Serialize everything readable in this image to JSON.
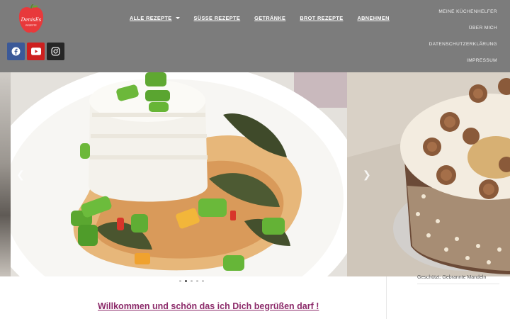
{
  "header": {
    "logo": {
      "text": "DenisEs",
      "sub": "REZEPTE"
    },
    "nav": [
      {
        "label": "ALLE REZEPTE",
        "has_dropdown": true
      },
      {
        "label": "SÜSSE REZEPTE"
      },
      {
        "label": "GETRÄNKE"
      },
      {
        "label": "BROT REZEPTE"
      },
      {
        "label": "ABNEHMEN"
      }
    ],
    "secondary_nav": [
      {
        "label": "MEINE KÜCHENHELFER"
      },
      {
        "label": "ÜBER MICH"
      },
      {
        "label": "DATENSCHUTZERKLÄRUNG"
      },
      {
        "label": "IMPRESSUM"
      }
    ],
    "social": [
      {
        "name": "facebook",
        "icon": "facebook-icon",
        "color": "#3b5998"
      },
      {
        "name": "youtube",
        "icon": "youtube-icon",
        "color": "#cd201f"
      },
      {
        "name": "instagram",
        "icon": "instagram-icon",
        "color": "#262626"
      }
    ],
    "background": "#7c7c7c"
  },
  "slider": {
    "slides": [
      {
        "subject": "rice with creamy vegetable sauce"
      },
      {
        "subject": "cake with almonds and cream rosettes"
      }
    ],
    "dot_count": 5,
    "active_dot": 1
  },
  "main": {
    "welcome": "Willkommen und schön das ich Dich begrüßen darf !"
  },
  "sidebar": {
    "caption": "Geschützt: Gebrannte Mandeln"
  },
  "colors": {
    "link_accent": "#8c2b6a",
    "logo_red": "#e8393b"
  }
}
